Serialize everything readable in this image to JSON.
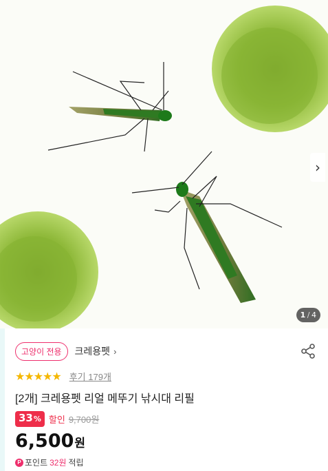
{
  "gallery": {
    "current": "1",
    "separator": "/",
    "total": "4",
    "next_icon": "chevron-right-icon"
  },
  "product": {
    "tag": "고양이 전용",
    "brand": "크레용펫",
    "brand_chevron": "›",
    "stars": "★★★★★",
    "rating": 5,
    "reviews": "후기 179개",
    "title": "[2개] 크레용펫 리얼 메뚜기 낚시대 리필",
    "discount_pct": "33",
    "discount_unit": "%",
    "discount_label": "할인",
    "original_price": "9,700원",
    "price": "6,500",
    "price_unit": "원",
    "points_icon": "P",
    "points_label": "포인트",
    "points_amount": "32원",
    "points_suffix": "적립"
  },
  "colors": {
    "accent": "#ee2e6c",
    "discount": "#ee2e4a",
    "star": "#f5b700"
  }
}
